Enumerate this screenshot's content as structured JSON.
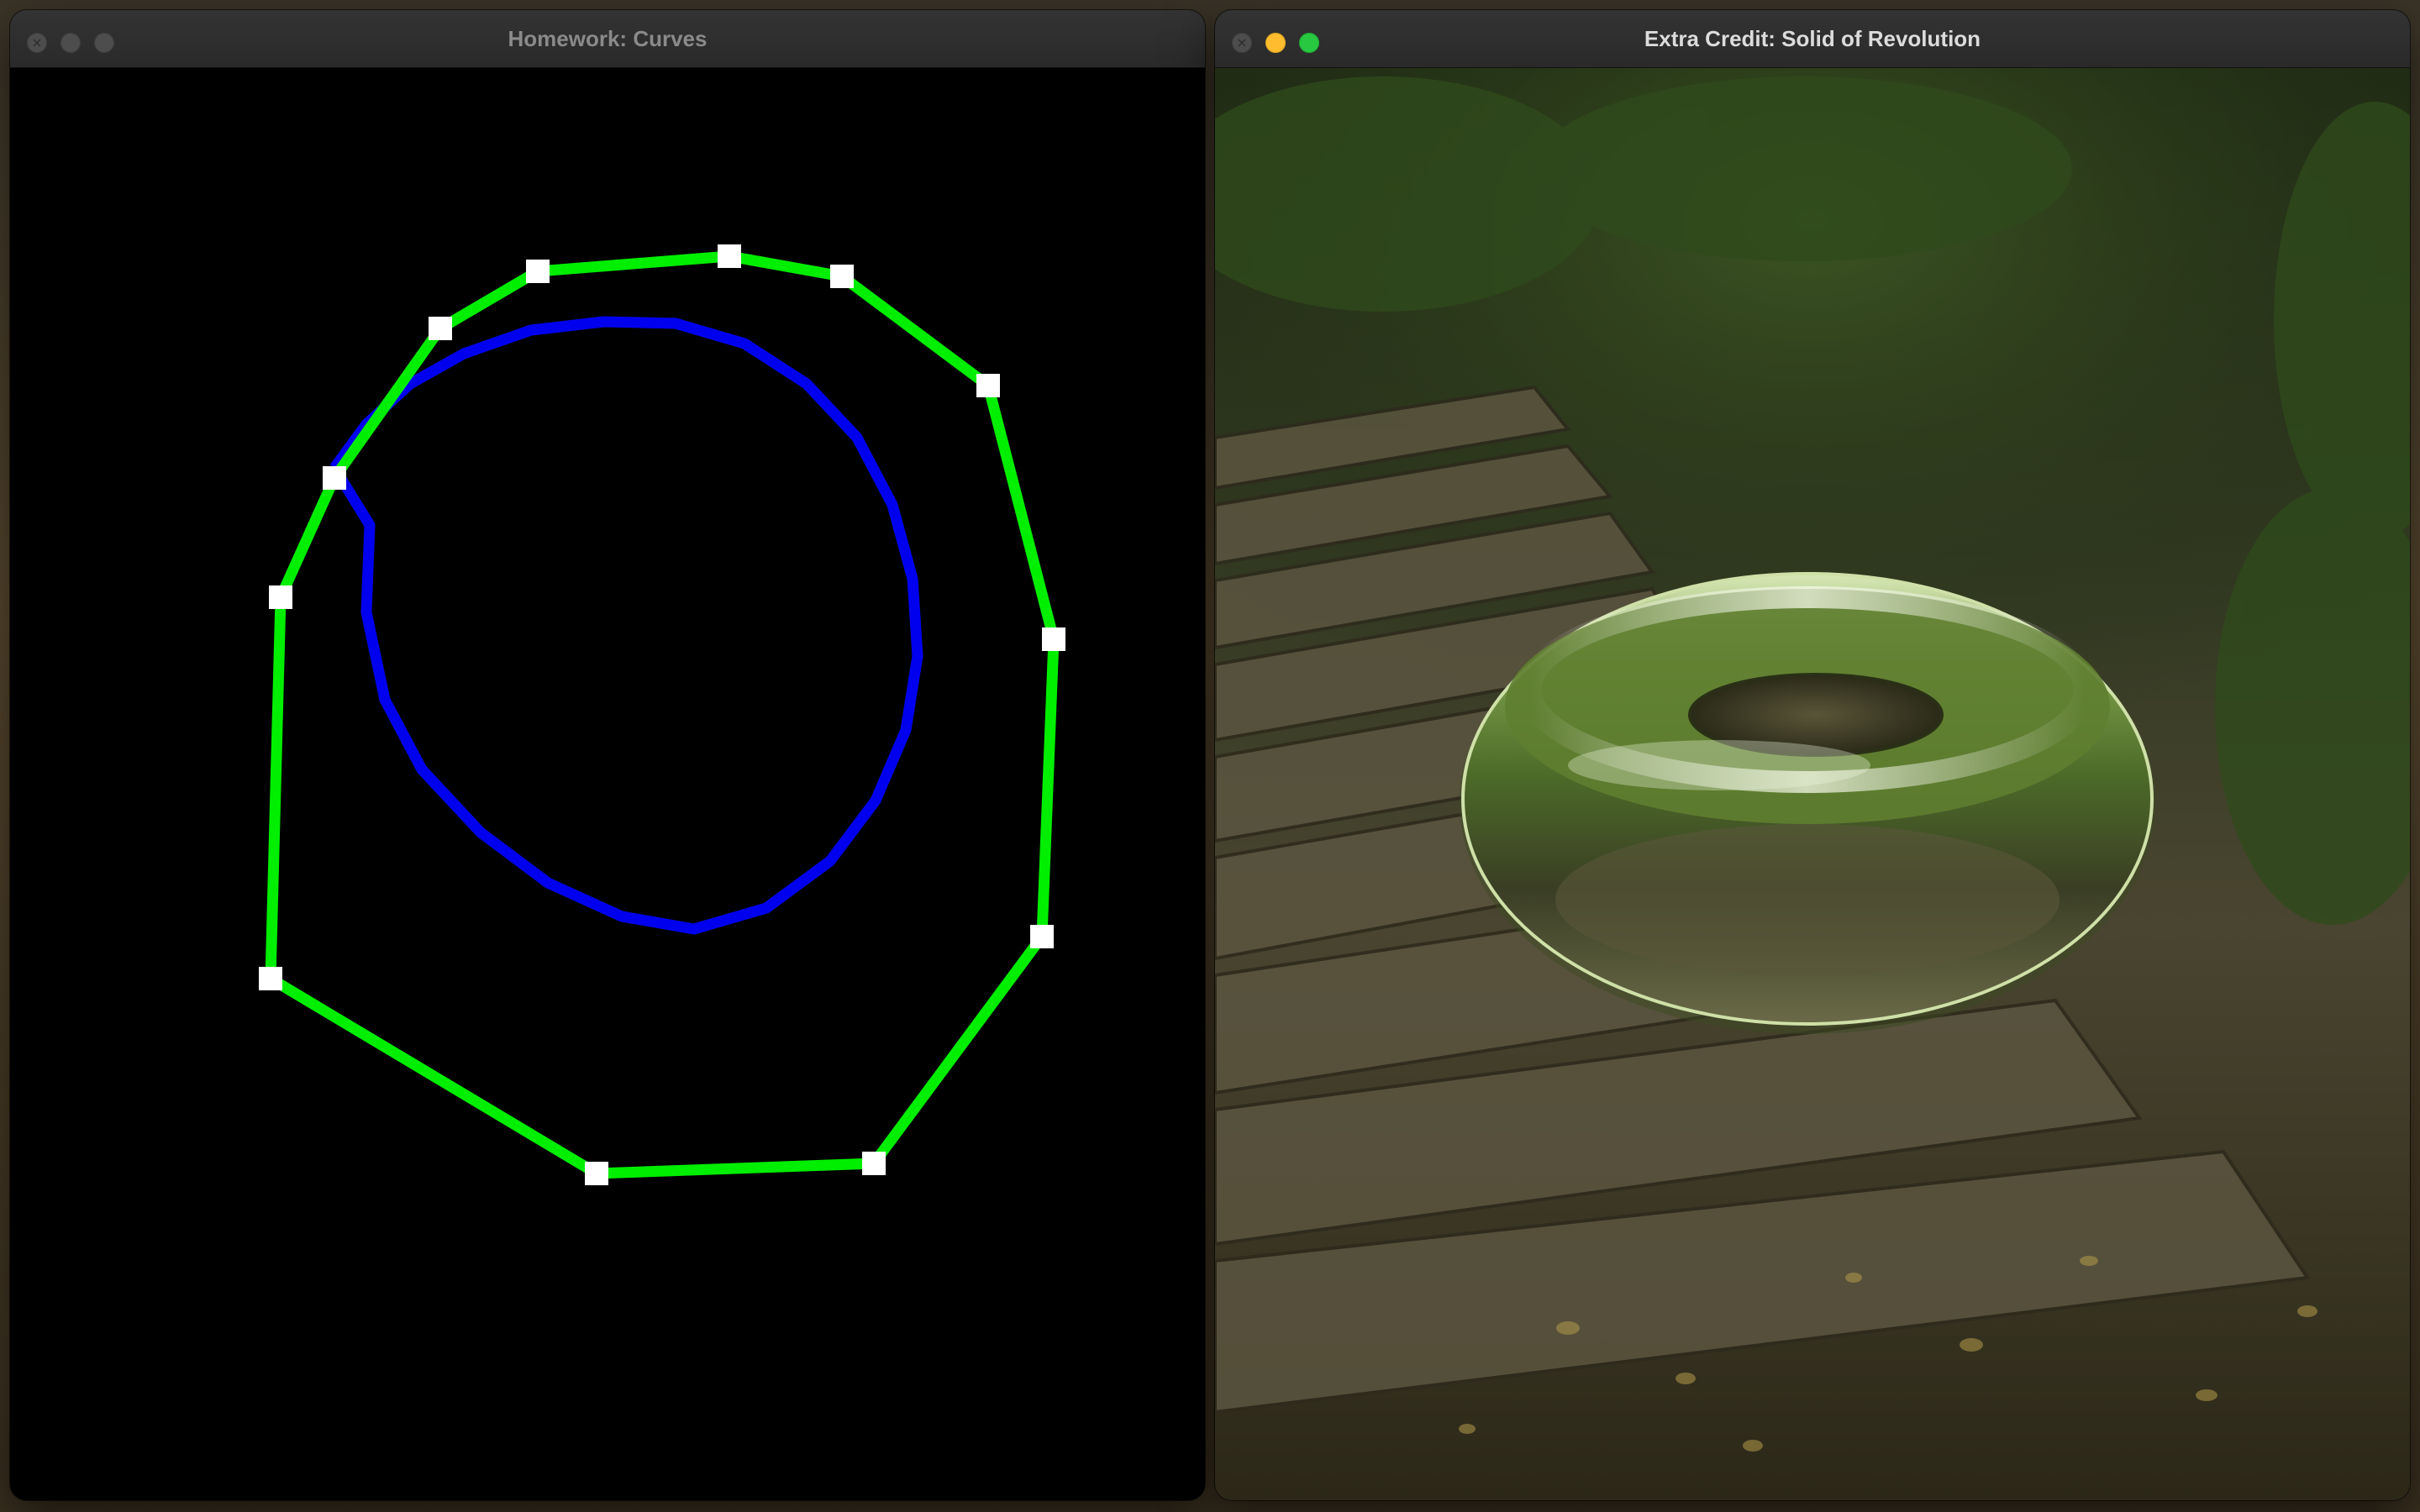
{
  "windows": [
    {
      "title": "Homework: Curves",
      "active": false,
      "controls": [
        "close",
        "minimize",
        "zoom"
      ]
    },
    {
      "title": "Extra Credit: Solid of Revolution",
      "active": true,
      "controls": [
        "close",
        "minimize",
        "zoom"
      ]
    }
  ],
  "curves_view": {
    "background": "#000000",
    "control_polygon_color": "#00ee00",
    "curve_color": "#0000ee",
    "control_point_color": "#ffffff",
    "control_polygon_closed": true,
    "control_point_count": 12
  },
  "solid_view": {
    "object": "torus",
    "material": "reflective (environment mapped)",
    "environment": "forest stairway",
    "colors": {
      "foliage": "#3f5a24",
      "stone": "#5b5540",
      "shadow": "#1e1c12",
      "highlight": "#e9f2d8"
    }
  }
}
